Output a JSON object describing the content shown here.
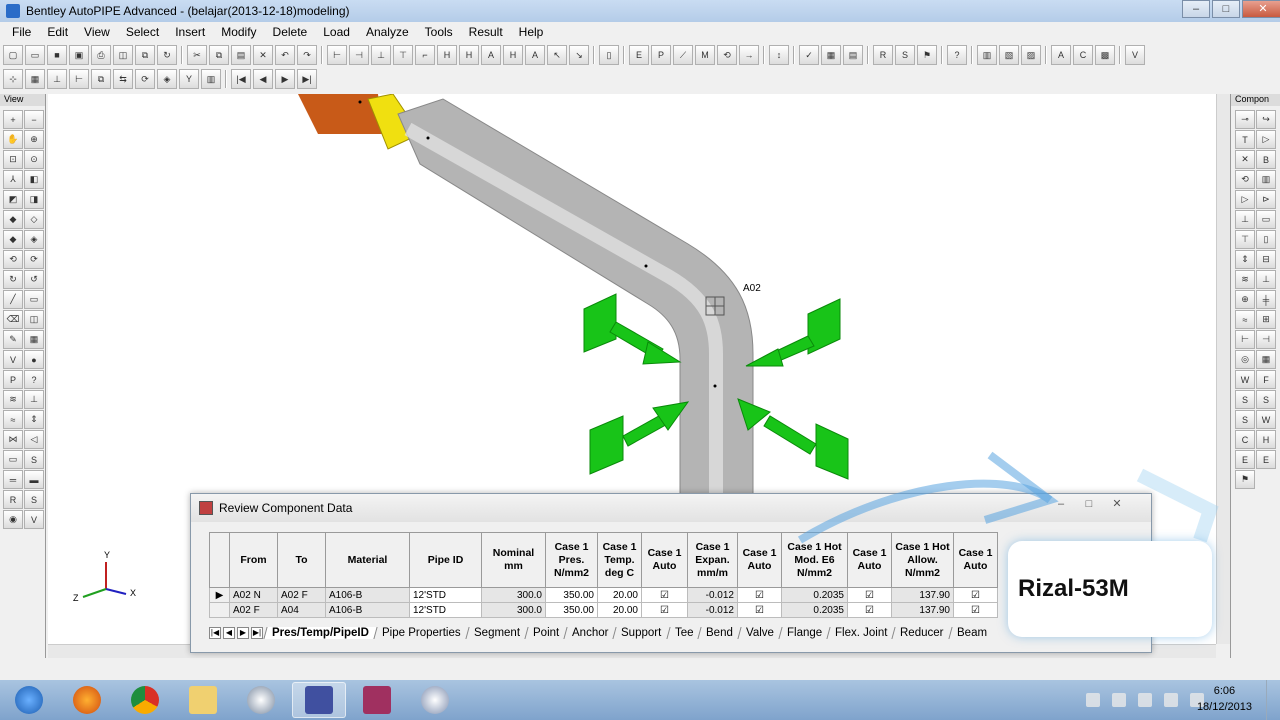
{
  "window": {
    "title": "Bentley AutoPIPE Advanced - (belajar(2013-12-18)modeling)"
  },
  "menu": [
    "File",
    "Edit",
    "View",
    "Select",
    "Insert",
    "Modify",
    "Delete",
    "Load",
    "Analyze",
    "Tools",
    "Result",
    "Help"
  ],
  "left_panel": {
    "header": "View"
  },
  "right_panel": {
    "header": "Compon"
  },
  "viewport": {
    "node_label": "A02",
    "axes": {
      "y": "Y",
      "x": "X",
      "z": "Z"
    }
  },
  "dialog": {
    "title": "Review Component Data",
    "columns": [
      "",
      "From",
      "To",
      "Material",
      "Pipe ID",
      "Nominal mm",
      "Case 1 Pres. N/mm2",
      "Case 1 Temp. deg C",
      "Case 1 Auto",
      "Case 1 Expan. mm/m",
      "Case 1 Auto",
      "Case 1 Hot Mod. E6 N/mm2",
      "Case 1 Auto",
      "Case 1 Hot Allow. N/mm2",
      "Case 1 Auto"
    ],
    "rows": [
      {
        "indicator": "▶",
        "from": "A02 N",
        "to": "A02 F",
        "material": "A106-B",
        "pipe_id": "12'STD",
        "nominal": "300.0",
        "pres": "350.00",
        "temp": "20.00",
        "expan": "-0.012",
        "hot_mod": "0.2035",
        "hot_allow": "137.90"
      },
      {
        "indicator": "",
        "from": "A02 F",
        "to": "A04",
        "material": "A106-B",
        "pipe_id": "12'STD",
        "nominal": "300.0",
        "pres": "350.00",
        "temp": "20.00",
        "expan": "-0.012",
        "hot_mod": "0.2035",
        "hot_allow": "137.90"
      }
    ],
    "tabs": [
      "Pres/Temp/PipeID",
      "Pipe Properties",
      "Segment",
      "Point",
      "Anchor",
      "Support",
      "Tee",
      "Bend",
      "Valve",
      "Flange",
      "Flex. Joint",
      "Reducer",
      "Beam"
    ]
  },
  "watermark": "Rizal-53M",
  "taskbar": {
    "time": "6:06",
    "date": "18/12/2013"
  }
}
